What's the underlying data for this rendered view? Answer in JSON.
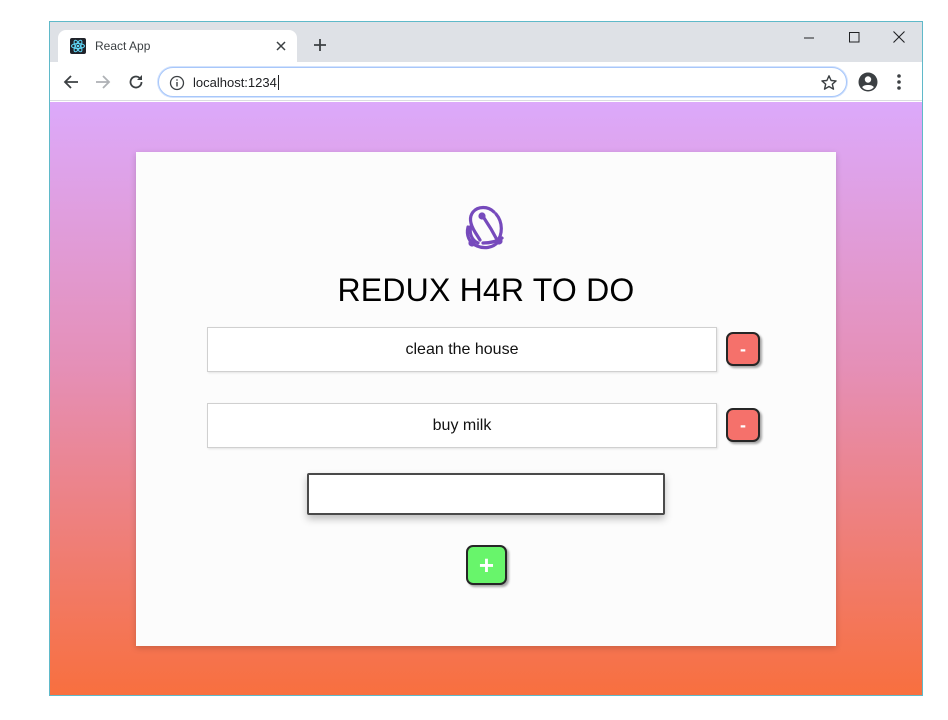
{
  "browser": {
    "tab_title": "React App",
    "url": "localhost:1234",
    "tab_favicon": "react-icon",
    "icons": {
      "back": "arrow-left-icon",
      "forward": "arrow-right-icon",
      "reload": "reload-icon",
      "info": "info-icon",
      "bookmark": "star-icon",
      "account": "account-icon",
      "menu": "kebab-menu-icon",
      "new_tab": "plus-icon",
      "close_tab": "close-icon",
      "minimize": "minimize-icon",
      "maximize": "maximize-icon",
      "close_window": "close-icon"
    }
  },
  "app": {
    "title": "REDUX H4R TO DO",
    "logo": "redux-logo-icon",
    "todos": [
      {
        "text": "clean the house",
        "remove_label": "-"
      },
      {
        "text": "buy milk",
        "remove_label": "-"
      }
    ],
    "new_todo": {
      "value": "",
      "placeholder": ""
    },
    "add_label": "+"
  },
  "colors": {
    "gradient_top": "#dca9fb",
    "gradient_bottom": "#f86f3e",
    "remove_button": "#f5716b",
    "add_button": "#68f56b",
    "logo": "#764abc"
  }
}
